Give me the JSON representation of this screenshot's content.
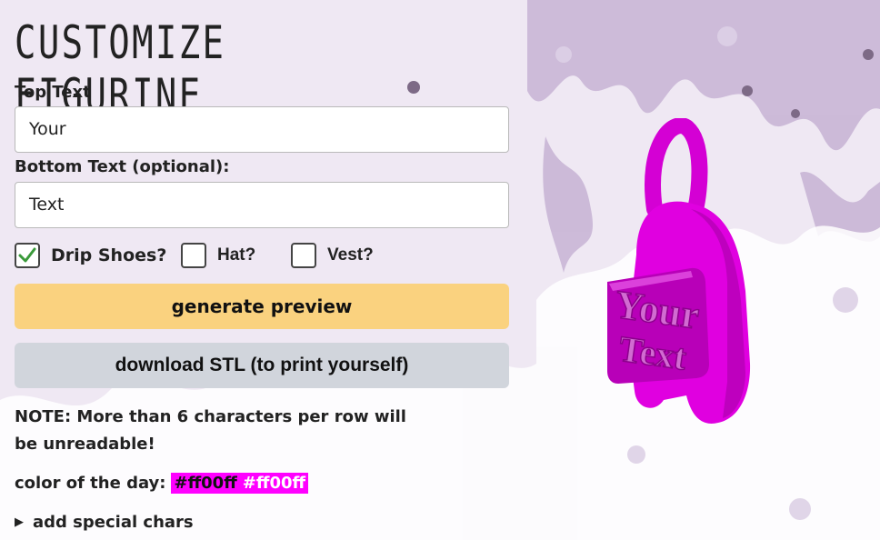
{
  "title": "CUSTOMIZE FIGURINE",
  "top_text": {
    "label": "Top Text",
    "value": "Your"
  },
  "bottom_text": {
    "label": "Bottom Text (optional):",
    "value": "Text"
  },
  "options": [
    {
      "label": "Drip Shoes?",
      "checked": true
    },
    {
      "label": "Hat?",
      "checked": false
    },
    {
      "label": "Vest?",
      "checked": false
    }
  ],
  "buttons": {
    "preview": "generate preview",
    "download": "download STL (to print yourself)"
  },
  "note": "NOTE: More than 6 characters per row will be unreadable!",
  "color_of_day": {
    "label": "color of the day:",
    "value": "#ff00ff",
    "value2": "#ff00ff",
    "color": "#ff00ff"
  },
  "details": {
    "label": "add special chars"
  },
  "preview_figure": {
    "line1": "Your",
    "line2": "Text",
    "color": "#ff00ff"
  }
}
